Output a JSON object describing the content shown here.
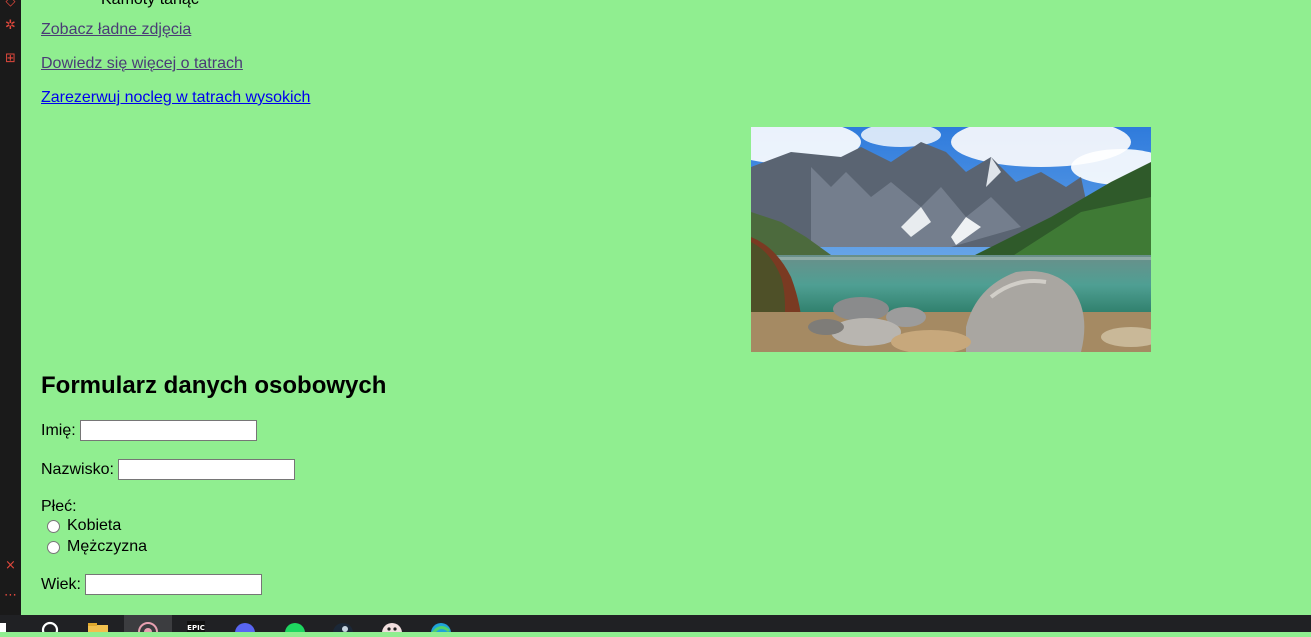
{
  "top_text": "Kamoty tanąć",
  "links": [
    {
      "label": "Zobacz ładne zdjęcia",
      "visited": true
    },
    {
      "label": "Dowiedz się więcej o tatrach",
      "visited": true
    },
    {
      "label": "Zarezerwuj nocleg w tatrach wysokich",
      "visited": false
    }
  ],
  "form": {
    "title": "Formularz danych osobowych",
    "first_name_label": "Imię:",
    "first_name_value": "",
    "last_name_label": "Nazwisko:",
    "last_name_value": "",
    "gender_label": "Płeć:",
    "gender_options": [
      "Kobieta",
      "Mężczyzna"
    ],
    "age_label": "Wiek:",
    "age_value": ""
  },
  "left_strip_icons": [
    "git-icon",
    "debug-icon",
    "extensions-icon",
    "close-icon",
    "more-icon"
  ],
  "taskbar_icons": [
    "start-icon",
    "search-icon",
    "file-explorer-icon",
    "app-icon",
    "epic-games-icon",
    "discord-icon",
    "spotify-icon",
    "steam-icon",
    "avatar-app-icon",
    "edge-icon"
  ],
  "colors": {
    "page_background": "#90ee90",
    "link_visited": "#4a3c76",
    "link_unvisited": "#0000ee"
  }
}
